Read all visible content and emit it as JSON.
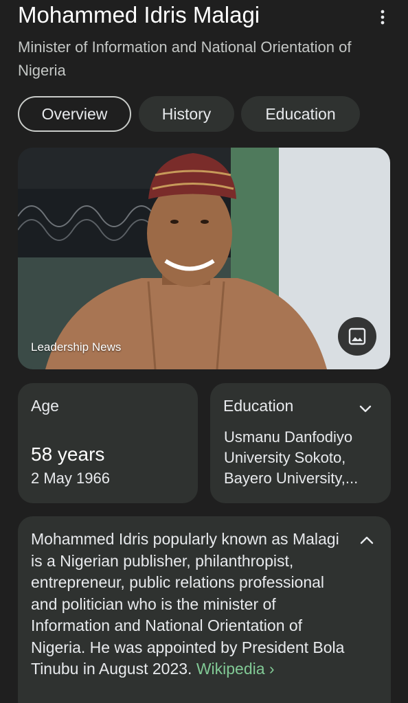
{
  "header": {
    "title": "Mohammed Idris Malagi",
    "subtitle": "Minister of Information and National Orientation of Nigeria",
    "more_icon": "more-vert-icon"
  },
  "tabs": [
    {
      "label": "Overview",
      "active": true
    },
    {
      "label": "History",
      "active": false
    },
    {
      "label": "Education",
      "active": false
    }
  ],
  "photo": {
    "source": "Leadership News",
    "image_button_icon": "image-icon"
  },
  "age_card": {
    "label": "Age",
    "value": "58 years",
    "birth_date": "2 May 1966"
  },
  "education_card": {
    "label": "Education",
    "value": "Usmanu Danfodiyo University Sokoto, Bayero University,...",
    "expand_icon": "chevron-down-icon"
  },
  "description": {
    "text": "Mohammed Idris popularly known as Malagi is a Nigerian publisher, philanthropist, entrepreneur, public relations professional and politician who is the minister of Information and National Orientation of Nigeria. He was appointed by President Bola Tinubu in August 2023.",
    "source_link": "Wikipedia ›",
    "collapse_icon": "chevron-up-icon"
  },
  "colors": {
    "background": "#1f1f1f",
    "card": "#2f3230",
    "link": "#81c995"
  }
}
